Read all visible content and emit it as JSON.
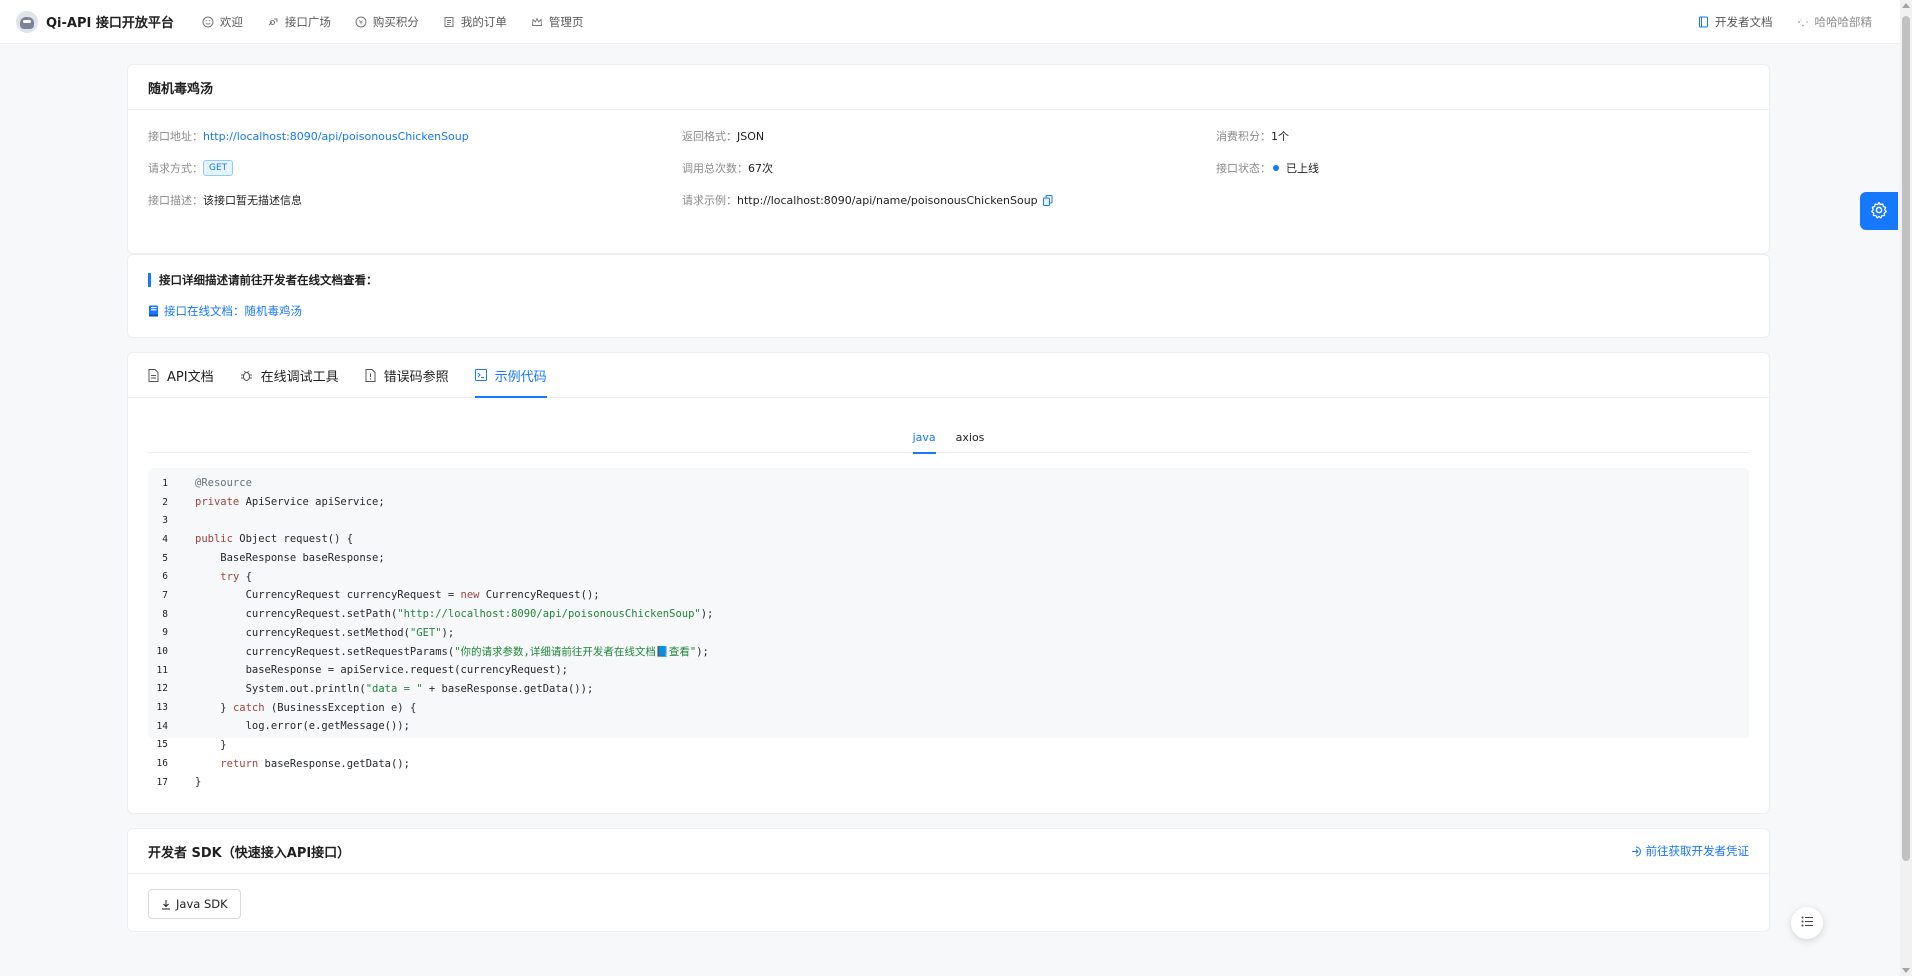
{
  "brand": {
    "title": "Qi-API 接口开放平台",
    "logo_icon": "raccoon-logo-icon"
  },
  "nav": {
    "items": [
      {
        "label": "欢迎",
        "icon": "smile-icon"
      },
      {
        "label": "接口广场",
        "icon": "api-icon"
      },
      {
        "label": "购买积分",
        "icon": "coin-icon"
      },
      {
        "label": "我的订单",
        "icon": "order-icon"
      },
      {
        "label": "管理页",
        "icon": "crown-icon"
      }
    ],
    "dev_docs": "开发者文档",
    "user_name": "哈哈哈部精"
  },
  "api": {
    "name": "随机毒鸡汤",
    "fields": {
      "address_label": "接口地址：",
      "address_value": "http://localhost:8090/api/poisonousChickenSoup",
      "return_label": "返回格式：",
      "return_value": "JSON",
      "cost_label": "消费积分：",
      "cost_value": "1个",
      "method_label": "请求方式：",
      "method_value": "GET",
      "total_label": "调用总次数：",
      "total_value": "67次",
      "status_label": "接口状态：",
      "status_value": "已上线",
      "desc_label": "接口描述：",
      "desc_value": "该接口暂无描述信息",
      "example_label": "请求示例：",
      "example_value": "http://localhost:8090/api/name/poisonousChickenSoup"
    }
  },
  "doc": {
    "heading": "接口详细描述请前往开发者在线文档查看：",
    "link": "接口在线文档：随机毒鸡汤"
  },
  "tabs": {
    "items": [
      {
        "label": "API文档",
        "icon": "file-icon"
      },
      {
        "label": "在线调试工具",
        "icon": "bug-icon"
      },
      {
        "label": "错误码参照",
        "icon": "exclamation-file-icon"
      },
      {
        "label": "示例代码",
        "icon": "code-icon"
      }
    ],
    "active": "示例代码"
  },
  "code": {
    "languages": [
      "java",
      "axios"
    ],
    "active_language": "java",
    "lines": [
      "@Resource",
      "private ApiService apiService;",
      "",
      "public Object request() {",
      "    BaseResponse baseResponse;",
      "    try {",
      "        CurrencyRequest currencyRequest = new CurrencyRequest();",
      "        currencyRequest.setPath(\"http://localhost:8090/api/poisonousChickenSoup\");",
      "        currencyRequest.setMethod(\"GET\");",
      "        currencyRequest.setRequestParams(\"你的请求参数,详细请前往开发者在线文档📘查看\");",
      "        baseResponse = apiService.request(currencyRequest);",
      "        System.out.println(\"data = \" + baseResponse.getData());",
      "    } catch (BusinessException e) {",
      "        log.error(e.getMessage());",
      "    }",
      "    return baseResponse.getData();",
      "}"
    ]
  },
  "sdk": {
    "title": "开发者 SDK（快速接入API接口）",
    "credential_link": "前往获取开发者凭证",
    "button": "Java SDK"
  },
  "colors": {
    "accent": "#1677ff",
    "code_bg": "#f6f8fa",
    "page_bg": "#f7f8fa"
  }
}
